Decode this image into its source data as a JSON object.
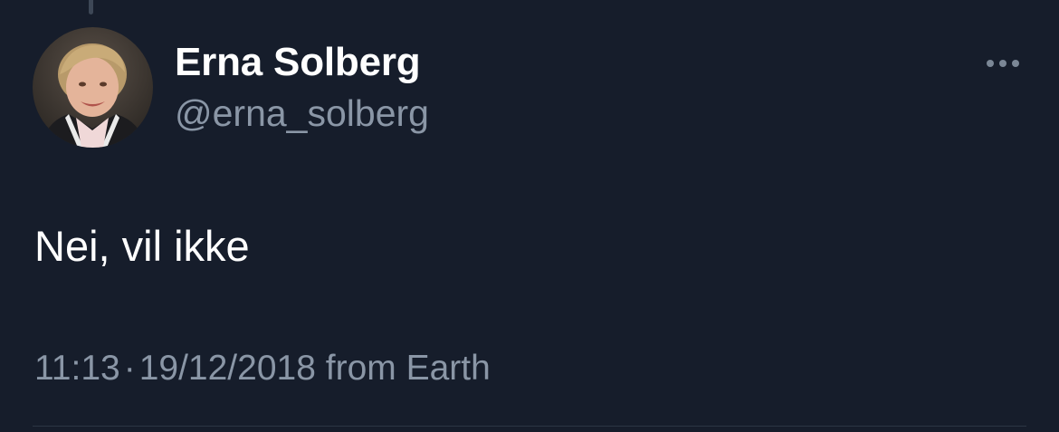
{
  "tweet": {
    "author": {
      "display_name": "Erna Solberg",
      "handle": "@erna_solberg",
      "avatar_icon": "profile-photo"
    },
    "text": "Nei, vil ikke",
    "time": "11:13",
    "separator": "·",
    "date": "19/12/2018",
    "source": "from Earth",
    "more_icon": "ellipsis-icon"
  },
  "colors": {
    "background": "#161d2b",
    "text_primary": "#ffffff",
    "text_secondary": "#8a96a6",
    "divider": "#2c3644"
  }
}
